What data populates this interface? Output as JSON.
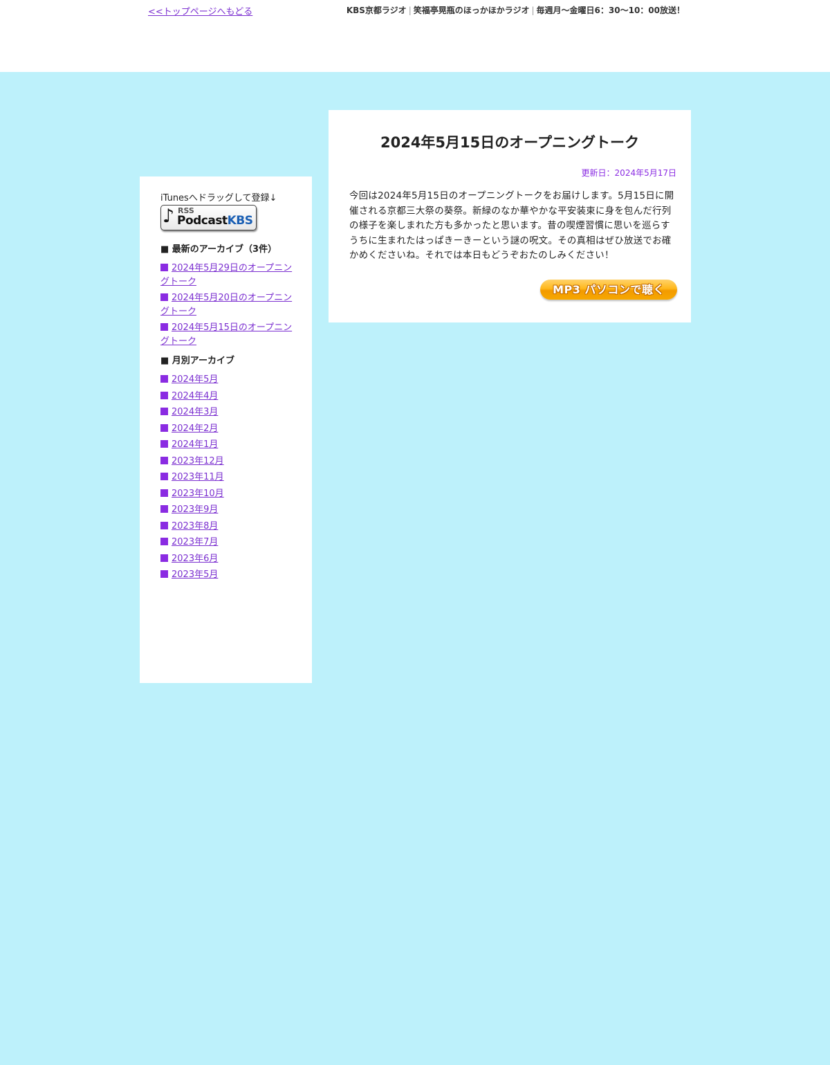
{
  "header": {
    "back_link": "<<トップページへもどる",
    "station": "KBS京都ラジオ",
    "program": "笑福亭晃瓶のほっかほかラジオ",
    "schedule": "毎週月〜金曜日6：30〜10：00放送！",
    "separator": "|"
  },
  "sidebar": {
    "itunes_text": "iTunesへドラッグして登録↓",
    "podcast_badge": {
      "note_icon": "music-note-icon",
      "rss": "RSS",
      "podcast": "Podcast",
      "kbs": "KBS"
    },
    "latest_heading": "■ 最新のアーカイブ（3件）",
    "latest_items": [
      "2024年5月29日のオープニングトーク",
      "2024年5月20日のオープニングトーク",
      "2024年5月15日のオープニングトーク"
    ],
    "monthly_heading": "■ 月別アーカイブ",
    "monthly_items": [
      "2024年5月",
      "2024年4月",
      "2024年3月",
      "2024年2月",
      "2024年1月",
      "2023年12月",
      "2023年11月",
      "2023年10月",
      "2023年9月",
      "2023年8月",
      "2023年7月",
      "2023年6月",
      "2023年5月"
    ]
  },
  "article": {
    "title": "2024年5月15日のオープニングトーク",
    "updated": "更新日：2024年5月17日",
    "body": "今回は2024年5月15日のオープニングトークをお届けします。5月15日に開催される京都三大祭の葵祭。新緑のなか華やかな平安装束に身を包んだ行列の様子を楽しまれた方も多かったと思います。昔の喫煙習慣に思いを巡らすうちに生まれたはっぱきーきーという謎の呪文。その真相はぜひ放送でお確かめくださいね。それでは本日もどうぞおたのしみください！",
    "mp3_button": "MP3 パソコンで聴く"
  },
  "colors": {
    "background": "#bdf1fb",
    "link": "#7b2fd0",
    "bullet": "#8a2be2",
    "button": "#f7a800"
  }
}
